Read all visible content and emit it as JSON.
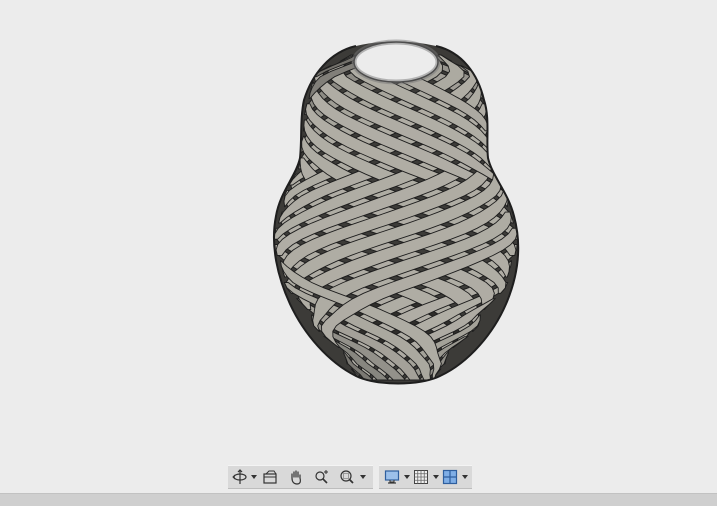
{
  "viewport": {
    "background": "#ececec",
    "model_name": "lattice-vase",
    "model_fill": "#8d8b84",
    "model_stroke": "#1e1e1e"
  },
  "toolbar": {
    "group_a": [
      {
        "icon": "orbit-icon",
        "has_dropdown": true
      },
      {
        "icon": "look-at-icon",
        "has_dropdown": false
      },
      {
        "icon": "pan-hand-icon",
        "has_dropdown": false
      },
      {
        "icon": "zoom-icon",
        "has_dropdown": false
      },
      {
        "icon": "fit-window-icon",
        "has_dropdown": true
      }
    ],
    "group_b": [
      {
        "icon": "display-settings-icon",
        "has_dropdown": true
      },
      {
        "icon": "grid-snap-icon",
        "has_dropdown": true
      },
      {
        "icon": "viewports-icon",
        "has_dropdown": true
      }
    ],
    "accent": "#3a72c4"
  }
}
